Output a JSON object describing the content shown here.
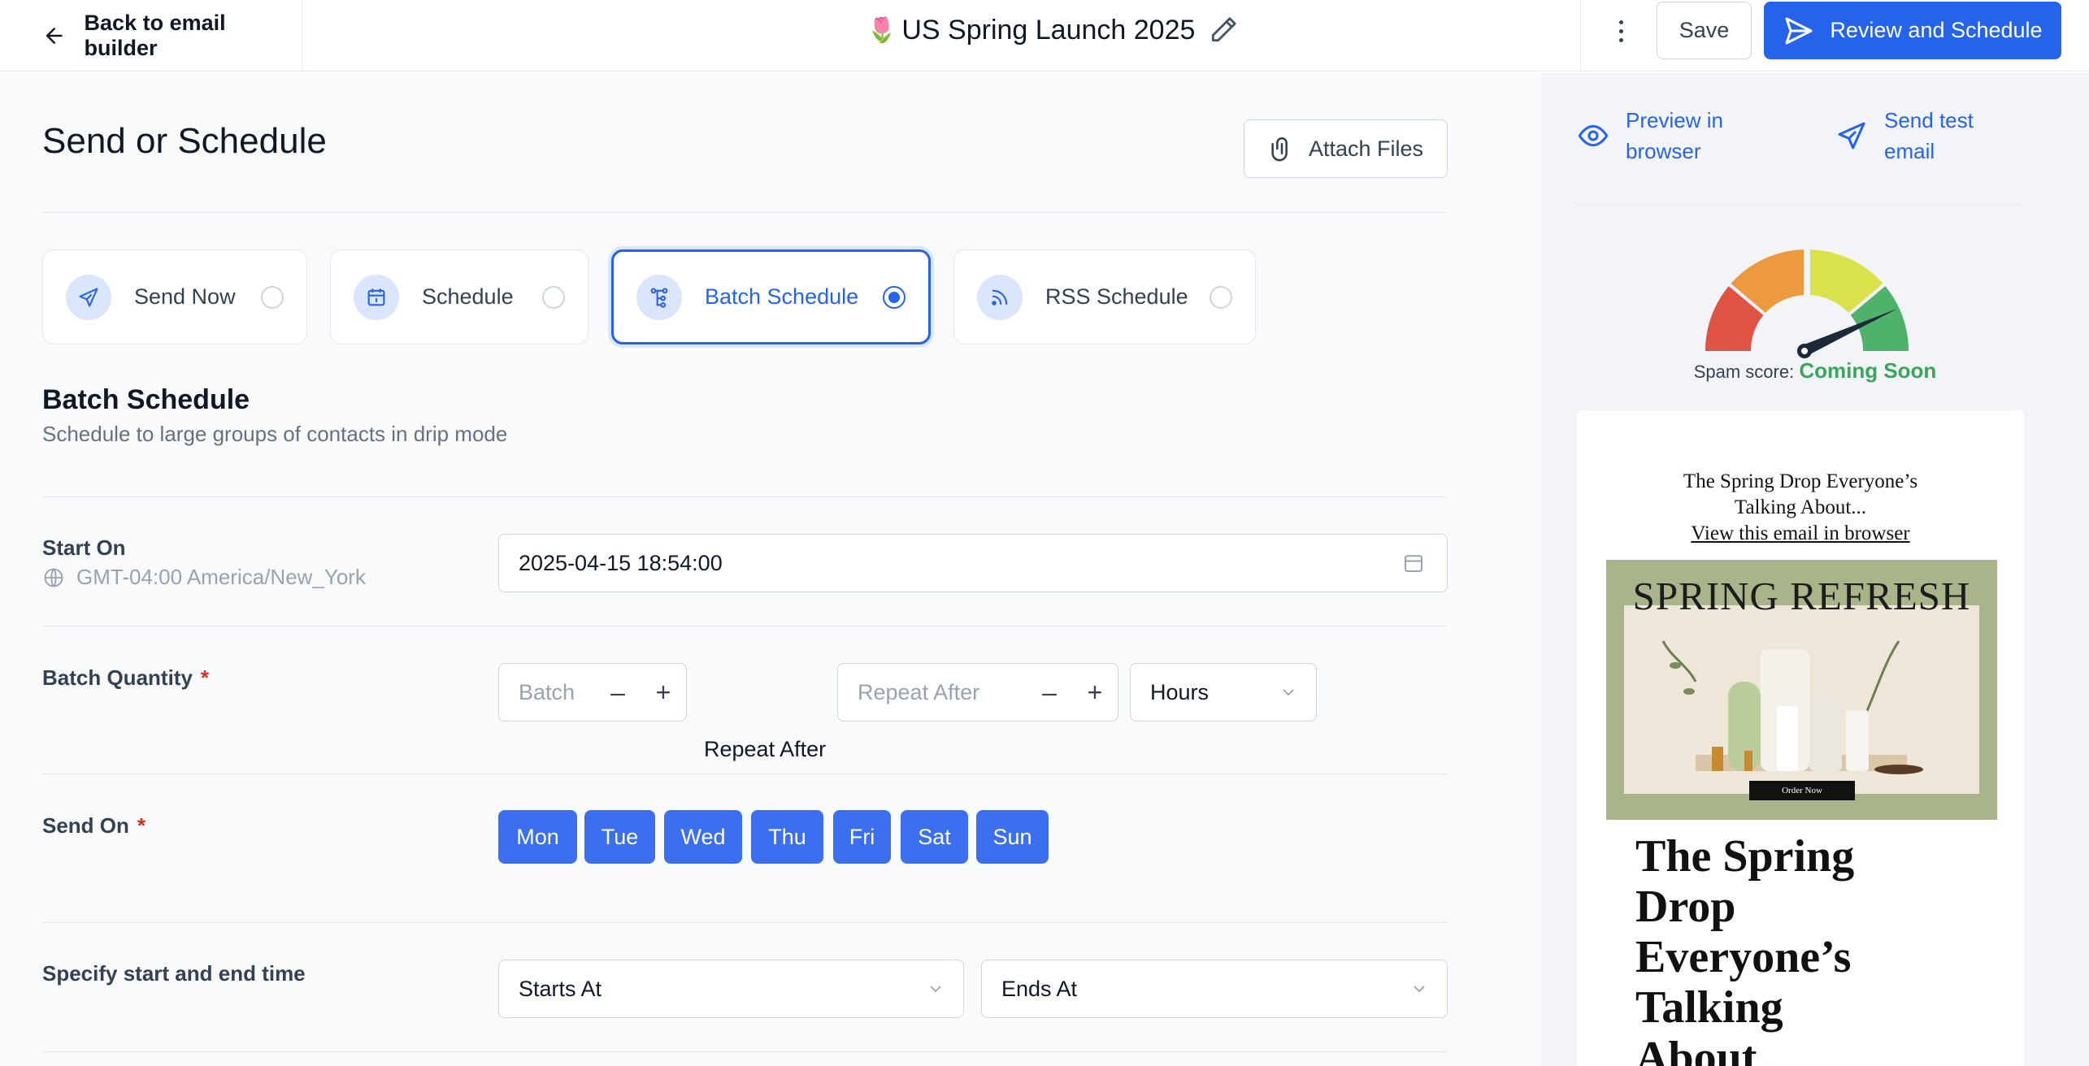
{
  "topbar": {
    "back_label": "Back to email builder",
    "title_emoji": "🌷",
    "title": "US Spring Launch 2025",
    "save_label": "Save",
    "review_label": "Review and Schedule"
  },
  "main": {
    "page_title": "Send or Schedule",
    "attach_label": "Attach Files",
    "options": [
      {
        "label": "Send Now",
        "icon": "send-icon",
        "selected": false
      },
      {
        "label": "Schedule",
        "icon": "calendar-icon",
        "selected": false
      },
      {
        "label": "Batch Schedule",
        "icon": "batch-icon",
        "selected": true
      },
      {
        "label": "RSS Schedule",
        "icon": "rss-icon",
        "selected": false
      }
    ],
    "section_title": "Batch Schedule",
    "section_subtitle": "Schedule to large groups of contacts in drip mode",
    "start_on": {
      "label": "Start On",
      "timezone": "GMT-04:00 America/New_York",
      "value": "2025-04-15 18:54:00"
    },
    "batch_quantity": {
      "label": "Batch Quantity",
      "required_mark": "*",
      "batch_placeholder": "Batch",
      "repeat_label": "Repeat After",
      "repeat_placeholder": "Repeat After",
      "unit": "Hours",
      "minus": "–",
      "plus": "+"
    },
    "send_on": {
      "label": "Send On",
      "required_mark": "*",
      "days": [
        "Mon",
        "Tue",
        "Wed",
        "Thu",
        "Fri",
        "Sat",
        "Sun"
      ]
    },
    "time_range": {
      "label": "Specify start and end time",
      "start_placeholder": "Starts At",
      "end_placeholder": "Ends At"
    }
  },
  "right_panel": {
    "preview_link": [
      "Preview in",
      "browser"
    ],
    "test_link": [
      "Send test",
      "email"
    ],
    "spam_label": "Spam score:",
    "spam_value": "Coming Soon",
    "email_preview": {
      "header_line1": "The Spring Drop Everyone’s",
      "header_line2": "Talking About...",
      "view_link": "View this email in browser",
      "banner_title": "SPRING REFRESH",
      "banner_button": "Order Now",
      "headline": [
        "The Spring",
        "Drop",
        "Everyone’s",
        "Talking",
        "About..."
      ]
    }
  },
  "colors": {
    "accent": "#2563eb",
    "gauge": [
      "#e05243",
      "#ec9a3d",
      "#d9e24b",
      "#4fb26a"
    ],
    "spam_value": "#3aa55b"
  }
}
